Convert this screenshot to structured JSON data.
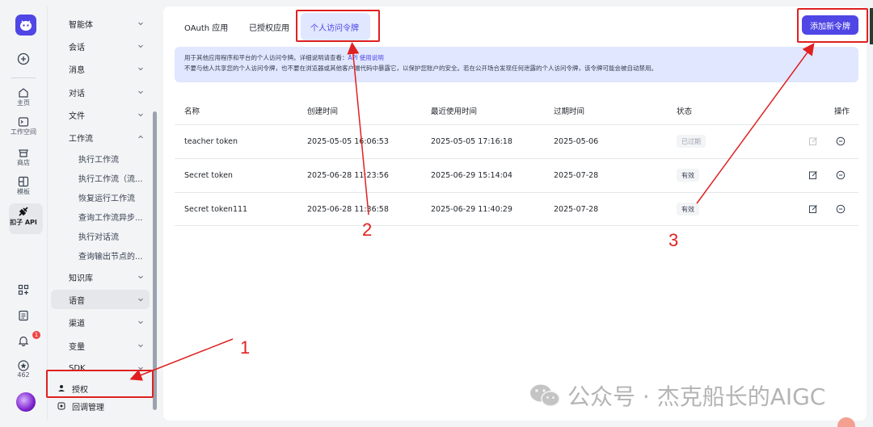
{
  "rail": {
    "items": [
      {
        "label": "主页"
      },
      {
        "label": "工作空间"
      },
      {
        "label": "商店"
      },
      {
        "label": "模板"
      },
      {
        "label": "扣子 API"
      }
    ],
    "notification_count": "1",
    "points": "462"
  },
  "nav": {
    "items": [
      {
        "label": "智能体"
      },
      {
        "label": "会话"
      },
      {
        "label": "消息"
      },
      {
        "label": "对话"
      },
      {
        "label": "文件"
      },
      {
        "label": "工作流"
      },
      {
        "label": "执行工作流"
      },
      {
        "label": "执行工作流（流..."
      },
      {
        "label": "恢复运行工作流"
      },
      {
        "label": "查询工作流异步..."
      },
      {
        "label": "执行对话流"
      },
      {
        "label": "查询输出节点的..."
      },
      {
        "label": "知识库"
      },
      {
        "label": "语音"
      },
      {
        "label": "渠道"
      },
      {
        "label": "变量"
      },
      {
        "label": "SDK"
      },
      {
        "label": "授权"
      },
      {
        "label": "回调管理"
      }
    ]
  },
  "tabs": [
    {
      "label": "OAuth 应用"
    },
    {
      "label": "已授权应用"
    },
    {
      "label": "个人访问令牌"
    }
  ],
  "add_button": "添加新令牌",
  "notice": {
    "line1_prefix": "用于其他应用程序和平台的个人访问令牌。详细说明请查看：",
    "line1_link": "API 使用说明",
    "line2": "不要与他人共享您的个人访问令牌，也不要在浏览器或其他客户端代码中暴露它，以保护您账户的安全。若在公开场合发现任何泄露的个人访问令牌，该令牌可能会被自动禁用。"
  },
  "table": {
    "headers": [
      "名称",
      "创建时间",
      "最近使用时间",
      "过期时间",
      "状态",
      "操作"
    ],
    "rows": [
      {
        "name": "teacher token",
        "created": "2025-05-05 16:06:53",
        "last_used": "2025-05-05 17:16:18",
        "expires": "2025-05-06",
        "status": "已过期",
        "status_kind": "expired"
      },
      {
        "name": "Secret token",
        "created": "2025-06-28 11:23:56",
        "last_used": "2025-06-29 15:14:04",
        "expires": "2025-07-28",
        "status": "有效",
        "status_kind": "valid"
      },
      {
        "name": "Secret token111",
        "created": "2025-06-28 11:36:58",
        "last_used": "2025-06-29 11:40:29",
        "expires": "2025-07-28",
        "status": "有效",
        "status_kind": "valid"
      }
    ]
  },
  "annotations": {
    "n1": "1",
    "n2": "2",
    "n3": "3"
  },
  "watermark": "公众号 · 杰克船长的AIGC",
  "colors": {
    "accent": "#4f46e5",
    "annotation": "#e02020",
    "tab_active_bg": "#e0e7ff"
  }
}
